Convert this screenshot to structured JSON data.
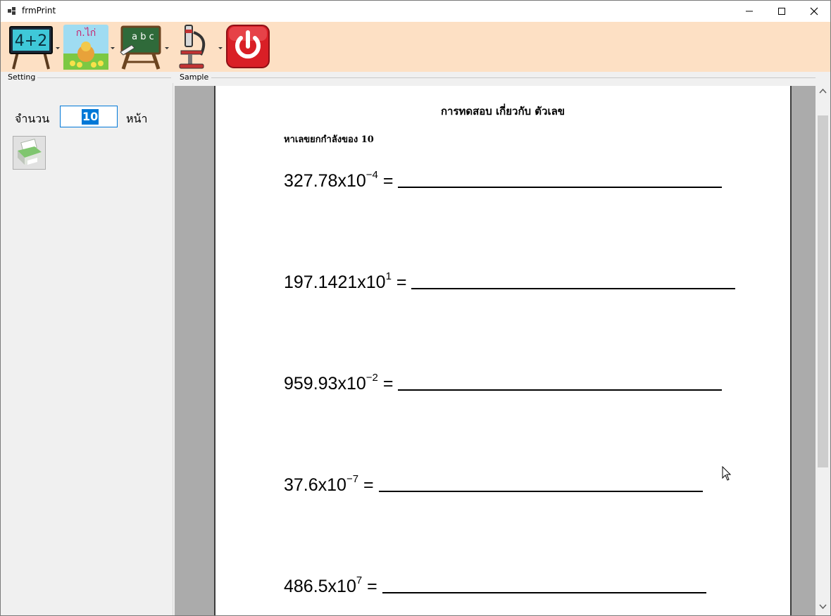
{
  "window": {
    "title": "frmPrint"
  },
  "toolbar": {
    "items": [
      {
        "name": "math-chalkboard-icon",
        "text": "4+2",
        "has_dropdown": true
      },
      {
        "name": "thai-alphabet-chicken-icon",
        "text": "ก.ไก่",
        "has_dropdown": true
      },
      {
        "name": "english-abc-chalkboard-icon",
        "text": "a b c",
        "has_dropdown": true
      },
      {
        "name": "microscope-icon",
        "has_dropdown": true
      },
      {
        "name": "power-icon",
        "has_dropdown": false
      }
    ]
  },
  "sections": {
    "setting": "Setting",
    "sample": "Sample"
  },
  "settings": {
    "count_label": "จำนวน",
    "count_value": "10",
    "unit_label": "หน้า",
    "print_icon": "printer-icon"
  },
  "document": {
    "title": "การทดสอบ เกี่ยวกับ ตัวเลข",
    "subtitle": "หาเลขยกกำลังของ 10",
    "problems": [
      {
        "base": "327.78x10",
        "exponent": "−4",
        "equals": "="
      },
      {
        "base": "197.1421x10",
        "exponent": "1",
        "equals": "="
      },
      {
        "base": "959.93x10",
        "exponent": "−2",
        "equals": "="
      },
      {
        "base": "37.6x10",
        "exponent": "−7",
        "equals": "="
      },
      {
        "base": "486.5x10",
        "exponent": "7",
        "equals": "="
      }
    ]
  },
  "colors": {
    "toolbar_bg": "#fde0c4",
    "selection": "#0078d7",
    "preview_bg": "#ababab"
  }
}
